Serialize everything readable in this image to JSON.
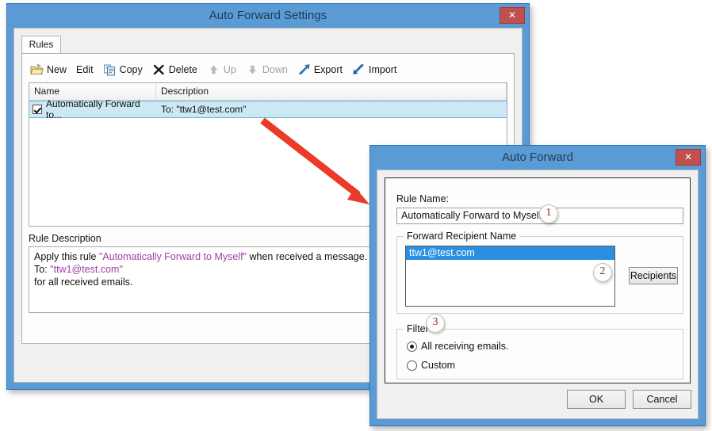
{
  "main_window": {
    "title": "Auto Forward Settings",
    "close_label": "✕",
    "close_icon": "close-icon",
    "tab": {
      "label": "Rules"
    },
    "toolbar": [
      {
        "label": "New",
        "icon": "new-folder-icon",
        "disabled": false
      },
      {
        "label": "Edit",
        "icon": "edit-icon",
        "disabled": false
      },
      {
        "label": "Copy",
        "icon": "copy-icon",
        "disabled": false
      },
      {
        "label": "Delete",
        "icon": "delete-x-icon",
        "disabled": false
      },
      {
        "label": "Up",
        "icon": "arrow-up-icon",
        "disabled": true
      },
      {
        "label": "Down",
        "icon": "arrow-down-icon",
        "disabled": true
      },
      {
        "label": "Export",
        "icon": "export-icon",
        "disabled": false
      },
      {
        "label": "Import",
        "icon": "import-icon",
        "disabled": false
      }
    ],
    "list": {
      "columns": [
        "Name",
        "Description"
      ],
      "rows": [
        {
          "checked": true,
          "name": "Automatically Forward to...",
          "description": "To: \"ttw1@test.com\""
        }
      ]
    },
    "rule_description": {
      "label": "Rule Description",
      "line1_pre": "Apply this rule ",
      "line1_quoted": "\"Automatically Forward to Myself\"",
      "line1_post": " when received a message.",
      "line2_pre": "To: ",
      "line2_quoted": "\"ttw1@test.com\"",
      "line3": "for all received emails."
    }
  },
  "forward_dialog": {
    "title": "Auto Forward",
    "close_label": "✕",
    "close_icon": "close-icon",
    "rule_name": {
      "label": "Rule Name:",
      "value": "Automatically Forward to Myself"
    },
    "recipient_group": {
      "legend": "Forward Recipient Name",
      "items": [
        "ttw1@test.com"
      ],
      "button_label": "Recipients"
    },
    "filter_group": {
      "legend": "Filter",
      "options": [
        {
          "label": "All receiving emails.",
          "selected": true
        },
        {
          "label": "Custom",
          "selected": false
        }
      ]
    },
    "ok_label": "OK",
    "cancel_label": "Cancel"
  },
  "annotations": {
    "badges": [
      "1",
      "2",
      "3"
    ],
    "arrow_color": "#ea3b2a"
  },
  "colors": {
    "title_bar": "#5b9bd5",
    "close_red": "#c0504d",
    "row_selected": "#cce8f4",
    "listbox_selected": "#2a8fe0",
    "quoted_text": "#a03fa0",
    "badge_text": "#8a2a14"
  }
}
